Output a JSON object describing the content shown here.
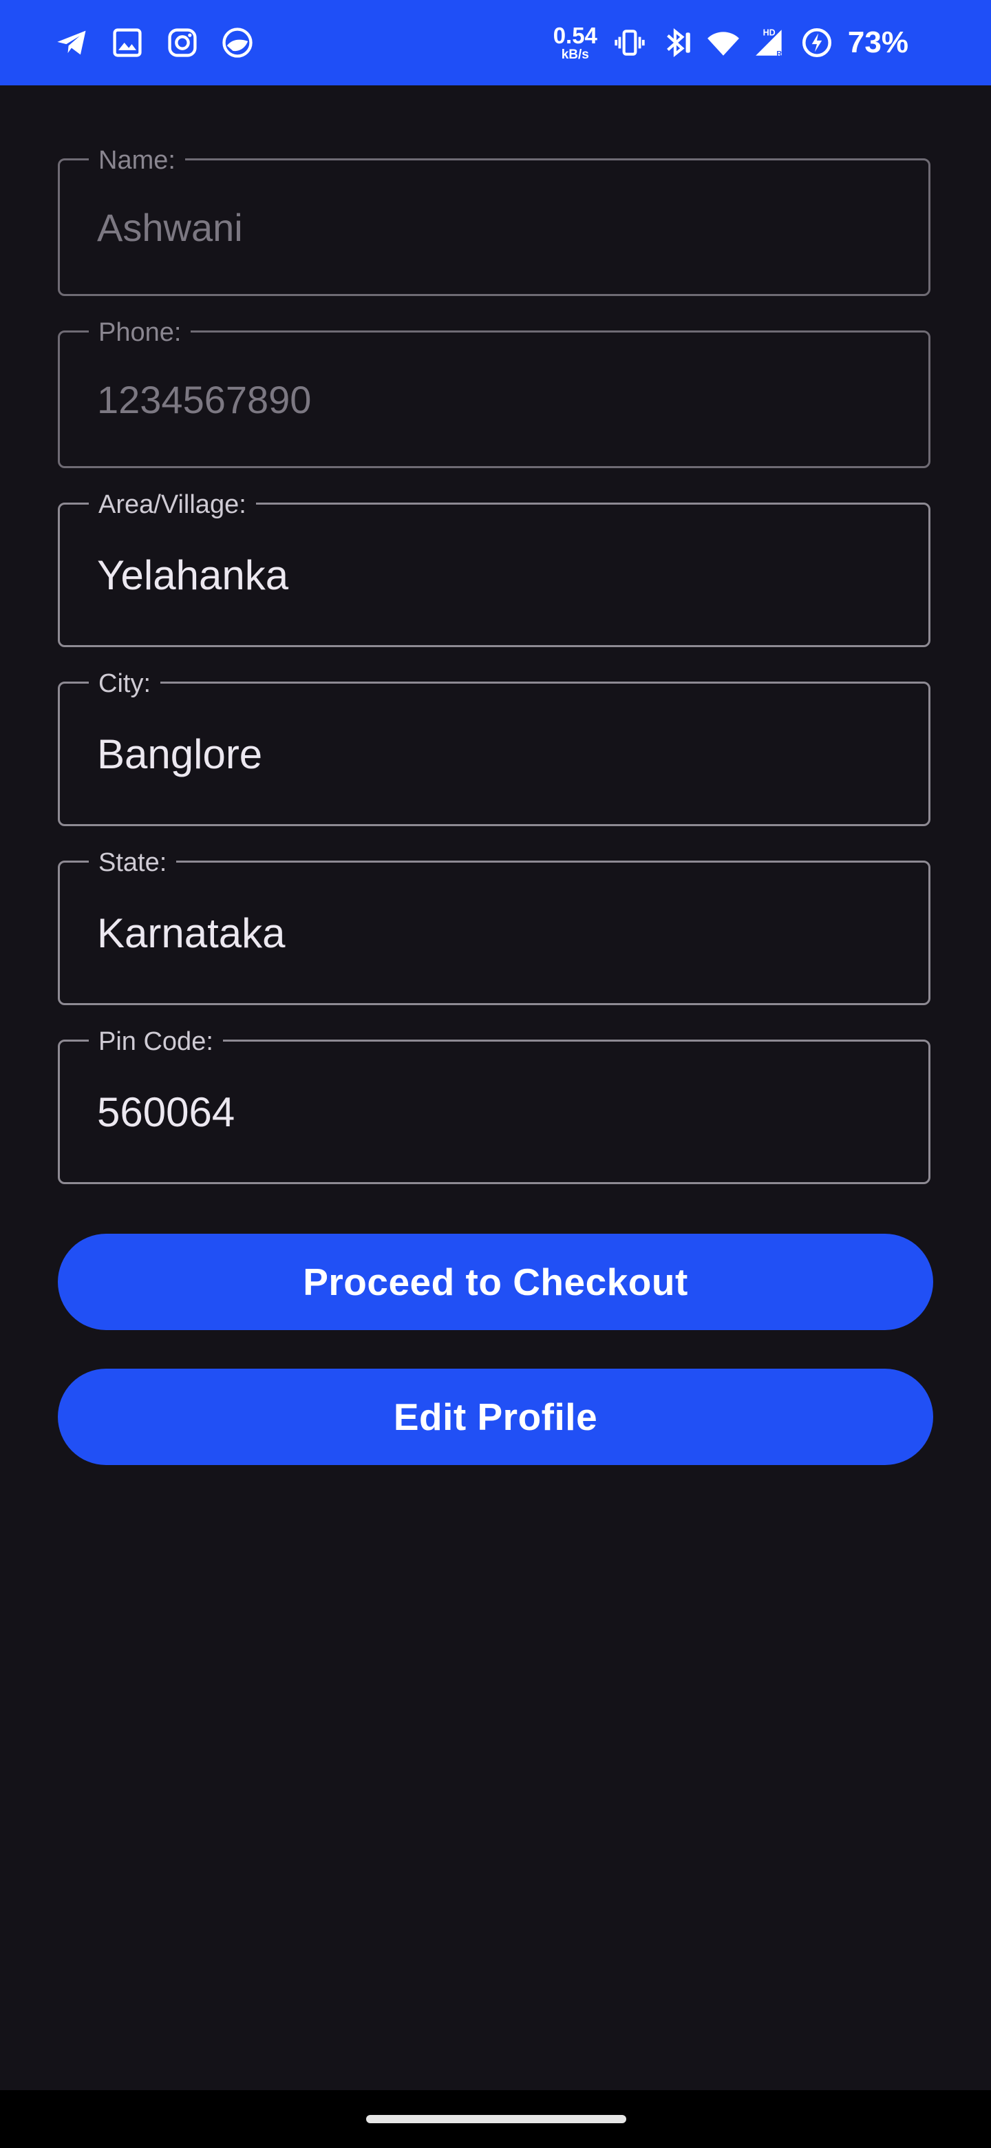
{
  "status_bar": {
    "background": "#1f4ff7",
    "left_icons": [
      "telegram-icon",
      "gallery-icon",
      "instagram-icon",
      "app-icon"
    ],
    "net_speed_value": "0.54",
    "net_speed_unit": "kB/s",
    "network_badge": "HD",
    "signal_badge": "R",
    "battery_percent": "73%"
  },
  "form": {
    "fields": [
      {
        "label": "Name:",
        "value": "Ashwani",
        "enabled": false
      },
      {
        "label": "Phone:",
        "value": "1234567890",
        "enabled": false
      },
      {
        "label": "Area/Village:",
        "value": "Yelahanka",
        "enabled": true
      },
      {
        "label": "City:",
        "value": "Banglore",
        "enabled": true
      },
      {
        "label": "State:",
        "value": "Karnataka",
        "enabled": true
      },
      {
        "label": "Pin Code:",
        "value": "560064",
        "enabled": true
      }
    ]
  },
  "actions": {
    "checkout_label": "Proceed to Checkout",
    "edit_profile_label": "Edit Profile",
    "button_color": "#2150f5"
  },
  "theme": {
    "background": "#141218"
  }
}
